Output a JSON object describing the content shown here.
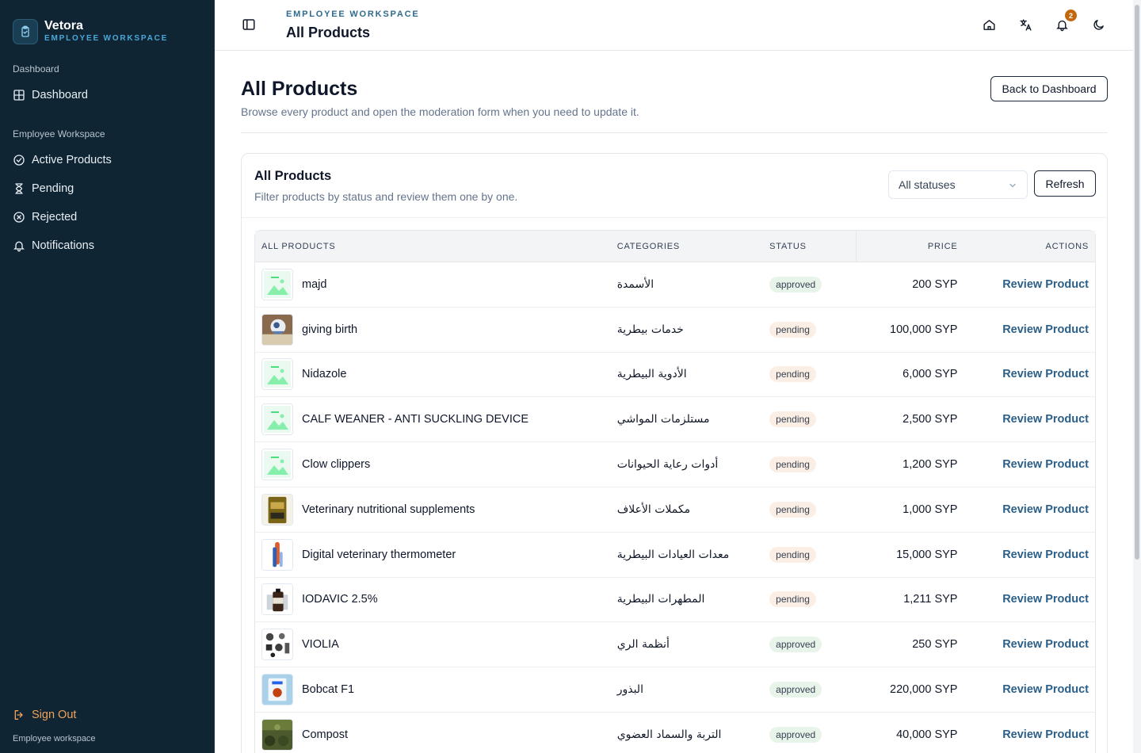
{
  "brand": {
    "name": "Vetora",
    "subtitle": "EMPLOYEE WORKSPACE"
  },
  "sidebar": {
    "sections": [
      {
        "heading": "Dashboard",
        "items": [
          {
            "label": "Dashboard",
            "icon": "grid-icon"
          }
        ]
      },
      {
        "heading": "Employee Workspace",
        "items": [
          {
            "label": "Active Products",
            "icon": "check-circle-icon"
          },
          {
            "label": "Pending",
            "icon": "hourglass-icon"
          },
          {
            "label": "Rejected",
            "icon": "x-circle-icon"
          },
          {
            "label": "Notifications",
            "icon": "bell-icon"
          }
        ]
      }
    ],
    "sign_out": "Sign Out",
    "footer_note": "Employee workspace"
  },
  "topbar": {
    "eyebrow": "EMPLOYEE WORKSPACE",
    "title": "All Products",
    "notification_count": "2",
    "icons": [
      "home-icon",
      "translate-icon",
      "bell-icon",
      "moon-icon"
    ]
  },
  "page": {
    "title": "All Products",
    "subtitle": "Browse every product and open the moderation form when you need to update it.",
    "back_button": "Back to Dashboard"
  },
  "card": {
    "title": "All Products",
    "subtitle": "Filter products by status and review them one by one.",
    "filter_value": "All statuses",
    "refresh_label": "Refresh"
  },
  "table": {
    "headers": {
      "product": "ALL PRODUCTS",
      "categories": "CATEGORIES",
      "status": "STATUS",
      "price": "PRICE",
      "actions": "ACTIONS"
    },
    "action_label": "Review Product",
    "rows": [
      {
        "name": "majd",
        "category": "الأسمدة",
        "status": "approved",
        "price": "200 SYP",
        "thumb": "placeholder"
      },
      {
        "name": "giving birth",
        "category": "خدمات بيطرية",
        "status": "pending",
        "price": "100,000 SYP",
        "thumb": "photo-birth"
      },
      {
        "name": "Nidazole",
        "category": "الأدوية البيطرية",
        "status": "pending",
        "price": "6,000 SYP",
        "thumb": "placeholder"
      },
      {
        "name": "CALF WEANER - ANTI SUCKLING DEVICE",
        "category": "مستلزمات المواشي",
        "status": "pending",
        "price": "2,500 SYP",
        "thumb": "placeholder"
      },
      {
        "name": "Clow clippers",
        "category": "أدوات رعاية الحيوانات",
        "status": "pending",
        "price": "1,200 SYP",
        "thumb": "placeholder"
      },
      {
        "name": "Veterinary nutritional supplements",
        "category": "مكملات الأعلاف",
        "status": "pending",
        "price": "1,000 SYP",
        "thumb": "photo-supplement"
      },
      {
        "name": "Digital veterinary thermometer",
        "category": "معدات العيادات البيطرية",
        "status": "pending",
        "price": "15,000 SYP",
        "thumb": "photo-thermometer"
      },
      {
        "name": "IODAVIC 2.5%",
        "category": "المطهرات البيطرية",
        "status": "pending",
        "price": "1,211 SYP",
        "thumb": "photo-bottle"
      },
      {
        "name": "VIOLIA",
        "category": "أنظمة الري",
        "status": "approved",
        "price": "250 SYP",
        "thumb": "photo-irrigation"
      },
      {
        "name": "Bobcat F1",
        "category": "البذور",
        "status": "approved",
        "price": "220,000 SYP",
        "thumb": "photo-seeds"
      },
      {
        "name": "Compost",
        "category": "التربة والسماد العضوي",
        "status": "approved",
        "price": "40,000 SYP",
        "thumb": "photo-compost"
      }
    ]
  },
  "colors": {
    "sidebar_bg": "#0f2533",
    "accent": "#4aa8d8",
    "link": "#2b5f88",
    "signout": "#f0a25a",
    "badge": "#c2690f"
  }
}
